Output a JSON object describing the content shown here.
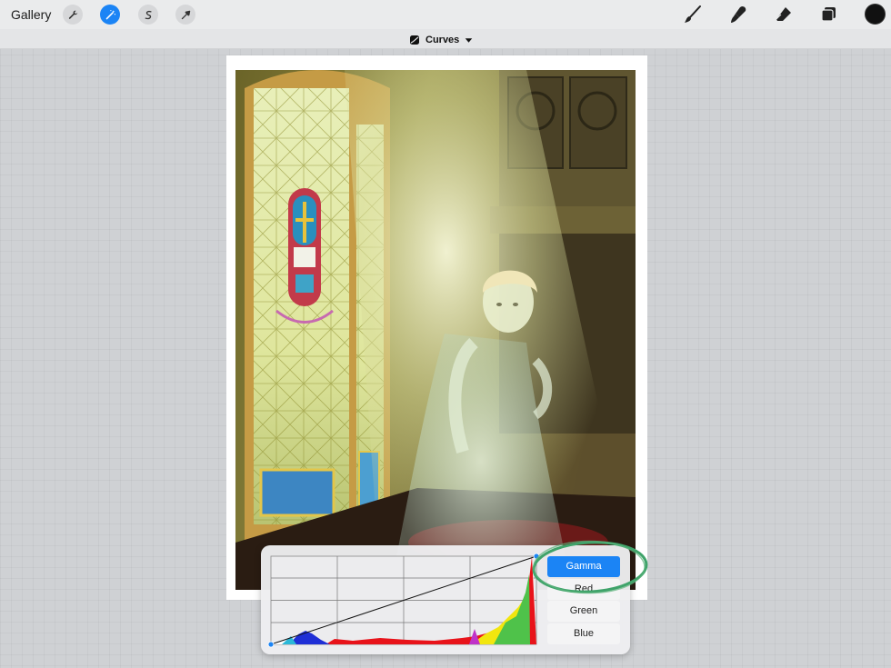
{
  "toolbar": {
    "gallery_label": "Gallery",
    "left_tools": [
      {
        "icon": "wrench-icon"
      },
      {
        "icon": "magic-wand-icon",
        "active": true
      },
      {
        "icon": "selection-s-icon"
      },
      {
        "icon": "arrow-cursor-icon"
      }
    ],
    "right_tools": [
      {
        "icon": "brush-icon"
      },
      {
        "icon": "smudge-icon"
      },
      {
        "icon": "eraser-icon"
      },
      {
        "icon": "layers-icon"
      }
    ],
    "current_color": "#111111"
  },
  "subbar": {
    "adjustment_name": "Curves"
  },
  "curves": {
    "channels": [
      {
        "label": "Gamma",
        "active": true
      },
      {
        "label": "Red",
        "active": false
      },
      {
        "label": "Green",
        "active": false
      },
      {
        "label": "Blue",
        "active": false
      }
    ],
    "accent_color": "#1b84f5"
  }
}
